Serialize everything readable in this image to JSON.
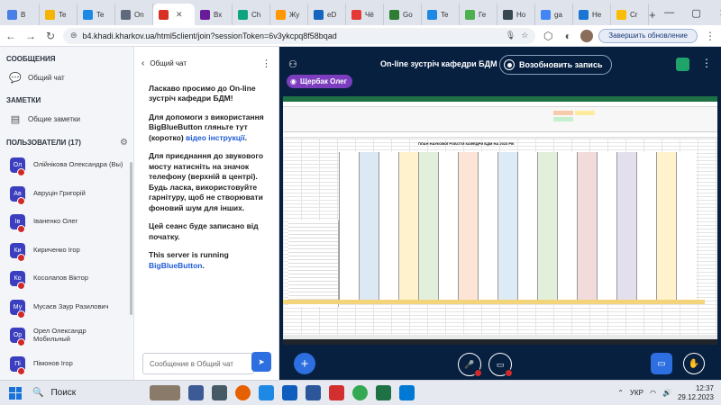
{
  "browser": {
    "tabs": [
      {
        "label": "В",
        "color": "#4a7fe6"
      },
      {
        "label": "Te",
        "color": "#f4b400"
      },
      {
        "label": "Te",
        "color": "#1e88e5"
      },
      {
        "label": "On",
        "color": "#5f6b7a"
      },
      {
        "label": "",
        "color": "#d93025",
        "active": true
      },
      {
        "label": "Вх",
        "color": "#6a1b9a"
      },
      {
        "label": "Ch",
        "color": "#10a37f"
      },
      {
        "label": "Жу",
        "color": "#ff9800"
      },
      {
        "label": "eD",
        "color": "#1565c0"
      },
      {
        "label": "Чё",
        "color": "#e53935"
      },
      {
        "label": "Go",
        "color": "#2e7d32"
      },
      {
        "label": "Te",
        "color": "#1e88e5"
      },
      {
        "label": "Ге",
        "color": "#4caf50"
      },
      {
        "label": "Ho",
        "color": "#37474f"
      },
      {
        "label": "ga",
        "color": "#4285f4"
      },
      {
        "label": "He",
        "color": "#1976d2"
      },
      {
        "label": "Cr",
        "color": "#fbbc04"
      }
    ],
    "url": "b4.khadi.kharkov.ua/html5client/join?sessionToken=6v3ykcpq8f58bqad",
    "update_label": "Завершить обновление"
  },
  "left": {
    "messages_header": "СООБЩЕНИЯ",
    "public_chat": "Общий чат",
    "notes_header": "ЗАМЕТКИ",
    "shared_notes": "Общие заметки",
    "users_header": "ПОЛЬЗОВАТЕЛИ (17)",
    "users": [
      {
        "initials": "Ол",
        "name": "Олійнікова Олександра (Вы)"
      },
      {
        "initials": "Ав",
        "name": "Авруцін Григорій"
      },
      {
        "initials": "Ів",
        "name": "Іваненко Олег"
      },
      {
        "initials": "Ки",
        "name": "Кириченко Ігор"
      },
      {
        "initials": "Ко",
        "name": "Косолапов Віктор"
      },
      {
        "initials": "Му",
        "name": "Мусаєв Заур Разилович"
      },
      {
        "initials": "Ор",
        "name": "Орел Олександр\nМобильный"
      },
      {
        "initials": "Пі",
        "name": "Пімонов Ігор"
      }
    ]
  },
  "chat": {
    "title": "Общий чат",
    "welcome": "Ласкаво просимо до On-line зустріч кафедри БДМ!",
    "help_prefix": "Для допомоги з використання BigBlueButton гляньте тут (коротко) ",
    "help_link": "відео інструкції",
    "help_suffix": ".",
    "phone_note": "Для приєднання до звукового мосту натисніть на значок телефону (верхній в центрі). Будь ласка, використовуйте гарнітуру, щоб не створювати фоновий шум для інших.",
    "recorded_note": "Цей сеанс буде записано від початку.",
    "running_prefix": "This server is running ",
    "running_link": "BigBlueButton",
    "running_suffix": ".",
    "input_placeholder": "Сообщение в Общий чат"
  },
  "main": {
    "meeting_title": "On-line зустріч кафедри БДМ",
    "record_label": "Возобновить запись",
    "presenter": "Щербак Олег",
    "sheet_title": "ПЛАН НАУКОВОЇ РОБОТИ КАФЕДРИ БДМ НА 2023 РІК"
  },
  "taskbar": {
    "search_label": "Поиск",
    "lang": "УКР",
    "time": "12:37",
    "date": "29.12.2023"
  }
}
